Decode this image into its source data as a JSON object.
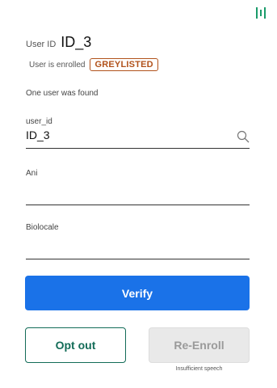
{
  "user": {
    "id_label": "User ID",
    "id_value": "ID_3",
    "enrolled_text": "User is enrolled",
    "status_badge": "GREYLISTED"
  },
  "search_result_text": "One user was found",
  "fields": {
    "user_id": {
      "label": "user_id",
      "value": "ID_3"
    },
    "ani": {
      "label": "Ani",
      "value": ""
    },
    "biolocale": {
      "label": "Biolocale",
      "value": ""
    }
  },
  "actions": {
    "verify_label": "Verify",
    "opt_out_label": "Opt out",
    "re_enroll_label": "Re-Enroll",
    "re_enroll_note": "Insufficient speech"
  },
  "colors": {
    "accent_green": "#1a9b6a",
    "badge": "#b1521b",
    "primary": "#1a72e8",
    "opt_out": "#136c58",
    "disabled_bg": "#e9e9e9"
  },
  "icons": {
    "top_right": "columns-icon",
    "search": "search-icon"
  }
}
